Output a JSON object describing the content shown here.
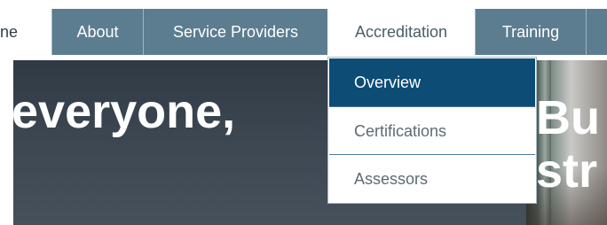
{
  "nav": {
    "items": [
      {
        "label": "ne"
      },
      {
        "label": "About"
      },
      {
        "label": "Service Providers"
      },
      {
        "label": "Accreditation"
      },
      {
        "label": "Training"
      },
      {
        "label": ""
      }
    ]
  },
  "dropdown": {
    "items": [
      {
        "label": "Overview",
        "selected": true
      },
      {
        "label": "Certifications",
        "selected": false
      },
      {
        "label": "Assessors",
        "selected": false
      }
    ]
  },
  "hero": {
    "headline_left": "everyone,",
    "headline_right_line1": "Bu",
    "headline_right_line2": "str"
  },
  "colors": {
    "nav_bg": "#5c7d8f",
    "dropdown_selected_bg": "#0d4d75",
    "hero_bg": "#3b4651"
  }
}
